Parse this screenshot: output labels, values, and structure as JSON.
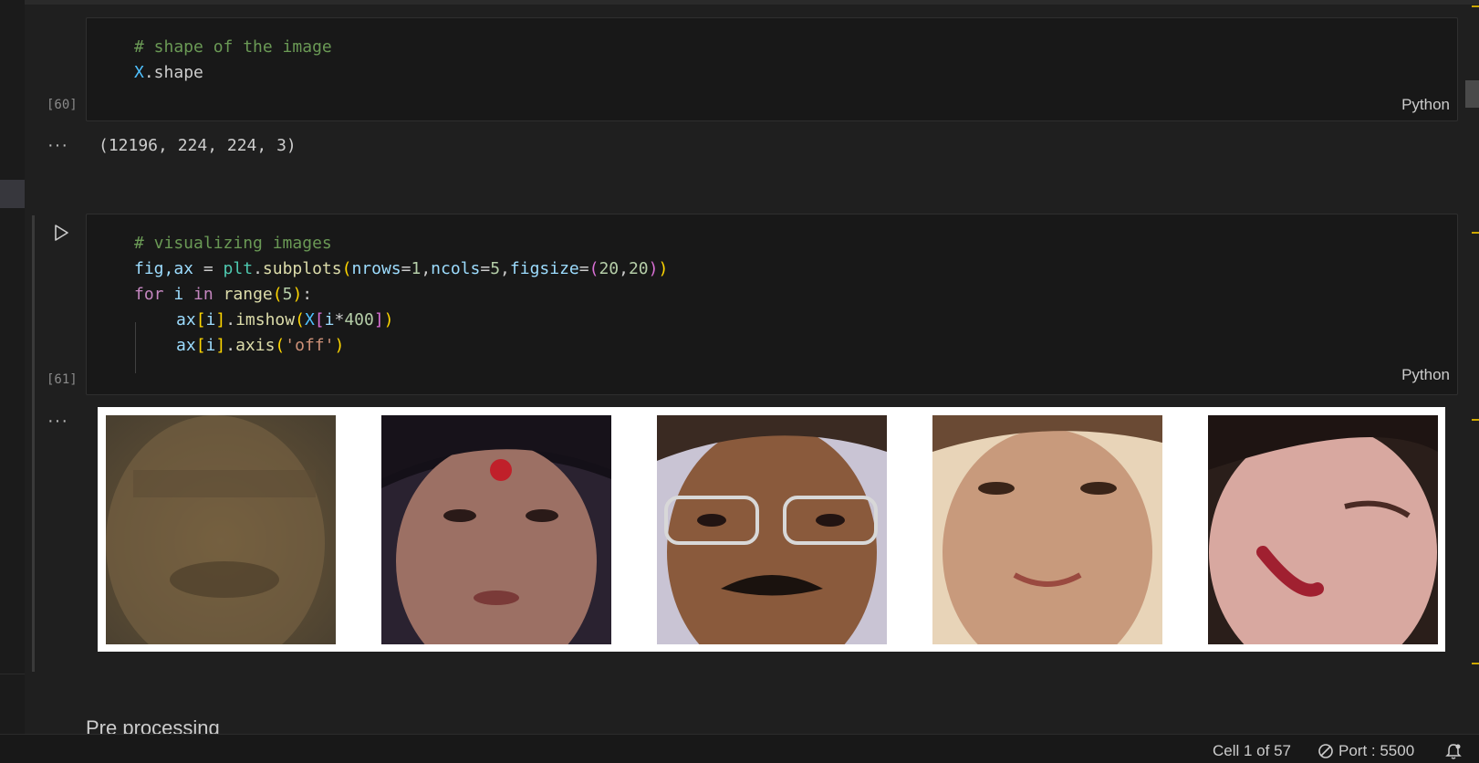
{
  "cells": [
    {
      "exec_count": "[60]",
      "language": "Python",
      "code": {
        "line1_comment": "# shape of the image",
        "line2_var": "X",
        "line2_attr": ".shape"
      },
      "output_text": "(12196, 224, 224, 3)"
    },
    {
      "exec_count": "[61]",
      "language": "Python",
      "code": {
        "l1_comment": "# visualizing images",
        "l2_a": "fig,ax",
        "l2_b": " = ",
        "l2_c": "plt",
        "l2_d": ".",
        "l2_e": "subplots",
        "l2_f": "(",
        "l2_g": "nrows",
        "l2_h": "=",
        "l2_i": "1",
        "l2_j": ",",
        "l2_k": "ncols",
        "l2_l": "=",
        "l2_m": "5",
        "l2_n": ",",
        "l2_o": "figsize",
        "l2_p": "=",
        "l2_q": "(",
        "l2_r": "20",
        "l2_s": ",",
        "l2_t": "20",
        "l2_u": ")",
        "l2_v": ")",
        "l3_for": "for",
        "l3_i": " i ",
        "l3_in": "in",
        "l3_sp": " ",
        "l3_range": "range",
        "l3_open": "(",
        "l3_5": "5",
        "l3_close": ")",
        "l3_colon": ":",
        "l4_ax": "ax",
        "l4_b1": "[",
        "l4_i": "i",
        "l4_b2": "]",
        "l4_dot": ".",
        "l4_fn": "imshow",
        "l4_p1": "(",
        "l4_X": "X",
        "l4_b3": "[",
        "l4_i2": "i",
        "l4_star": "*",
        "l4_400": "400",
        "l4_b4": "]",
        "l4_p2": ")",
        "l5_ax": "ax",
        "l5_b1": "[",
        "l5_i": "i",
        "l5_b2": "]",
        "l5_dot": ".",
        "l5_fn": "axis",
        "l5_p1": "(",
        "l5_str": "'off'",
        "l5_p2": ")"
      }
    }
  ],
  "output_dots": "···",
  "next_heading": "Pre processing",
  "status_bar": {
    "cell_position": "Cell 1 of 57",
    "port_icon": "blocked-circle-icon",
    "port_label": "Port : 5500",
    "bell_icon": "notification-bell-icon"
  },
  "colors": {
    "background": "#1f1f1f",
    "cell_background": "#181818",
    "comment": "#6a9955",
    "variable": "#9cdcfe",
    "function": "#dcdcaa",
    "keyword": "#c586c0"
  }
}
